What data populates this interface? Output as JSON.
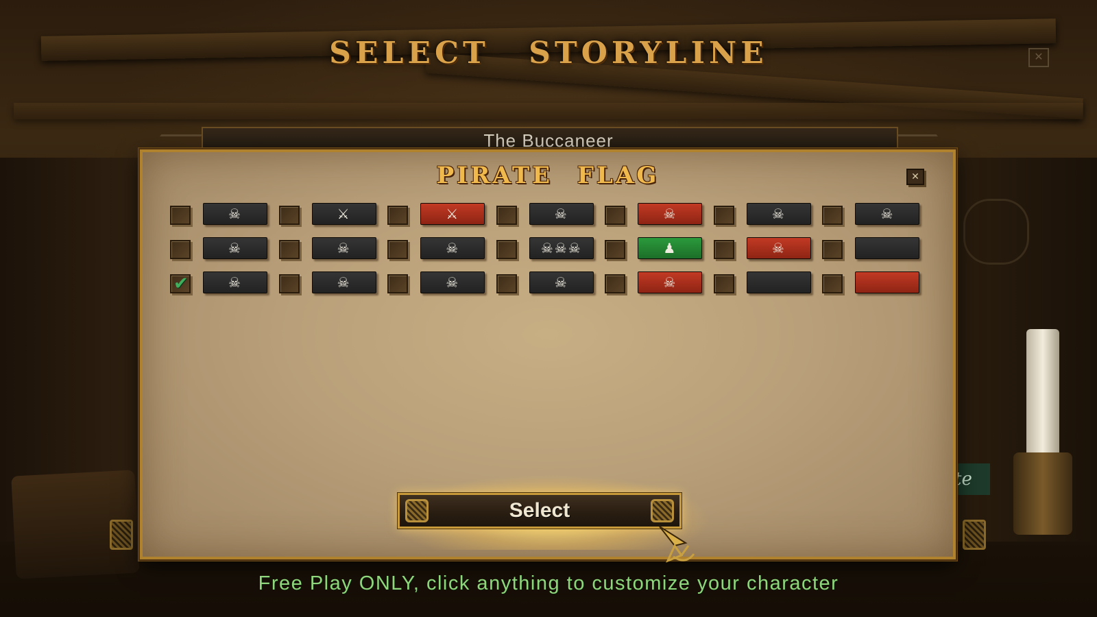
{
  "screen": {
    "title_words": [
      "SELECT",
      "STORYLINE"
    ],
    "close_glyph": "✕",
    "storyline_name": "The Buccaneer",
    "peek_text": "te"
  },
  "dialog": {
    "title_words": [
      "PIRATE",
      "FLAG"
    ],
    "close_glyph": "✕",
    "flag_rows": [
      [
        {
          "color": "black",
          "icon": "skull-crossed-swords",
          "glyph": "☠",
          "checked": false
        },
        {
          "color": "black",
          "icon": "cutlass",
          "glyph": "⚔",
          "checked": false
        },
        {
          "color": "red",
          "icon": "arm-cutlass",
          "glyph": "⚔",
          "checked": false
        },
        {
          "color": "black",
          "icon": "skull-crossbones",
          "glyph": "☠",
          "checked": false
        },
        {
          "color": "red",
          "icon": "skull-crossbones",
          "glyph": "☠",
          "checked": false
        },
        {
          "color": "black",
          "icon": "skeleton-spear-heart",
          "glyph": "☠",
          "checked": false
        },
        {
          "color": "black",
          "icon": "skull-crossbones",
          "glyph": "☠",
          "checked": false
        }
      ],
      [
        {
          "color": "black",
          "icon": "skeleton-figure",
          "glyph": "☠",
          "checked": false
        },
        {
          "color": "black",
          "icon": "skull-heart",
          "glyph": "☠",
          "checked": false
        },
        {
          "color": "black",
          "icon": "skull",
          "glyph": "☠",
          "checked": false
        },
        {
          "color": "black",
          "icon": "three-skulls",
          "glyph": "☠☠☠",
          "checked": false
        },
        {
          "color": "green",
          "icon": "figure",
          "glyph": "♟",
          "checked": false
        },
        {
          "color": "red",
          "icon": "arm-skull",
          "glyph": "☠",
          "checked": false
        },
        {
          "color": "black",
          "icon": "red-mark",
          "glyph": "",
          "checked": false
        }
      ],
      [
        {
          "color": "black",
          "icon": "two-figures",
          "glyph": "☠",
          "checked": true
        },
        {
          "color": "black",
          "icon": "skull-crossbones",
          "glyph": "☠",
          "checked": false
        },
        {
          "color": "black",
          "icon": "skeleton-hourglass",
          "glyph": "☠",
          "checked": false
        },
        {
          "color": "black",
          "icon": "skull-crossbones",
          "glyph": "☠",
          "checked": false
        },
        {
          "color": "red",
          "icon": "skull-crossbones",
          "glyph": "☠",
          "checked": false
        },
        {
          "color": "black",
          "icon": "plain",
          "glyph": "",
          "checked": false
        },
        {
          "color": "red",
          "icon": "plain",
          "glyph": "",
          "checked": false
        }
      ]
    ],
    "check_glyph": "✔",
    "select_label": "Select"
  },
  "footer": {
    "hint": "Free Play ONLY, click anything to customize your character"
  }
}
